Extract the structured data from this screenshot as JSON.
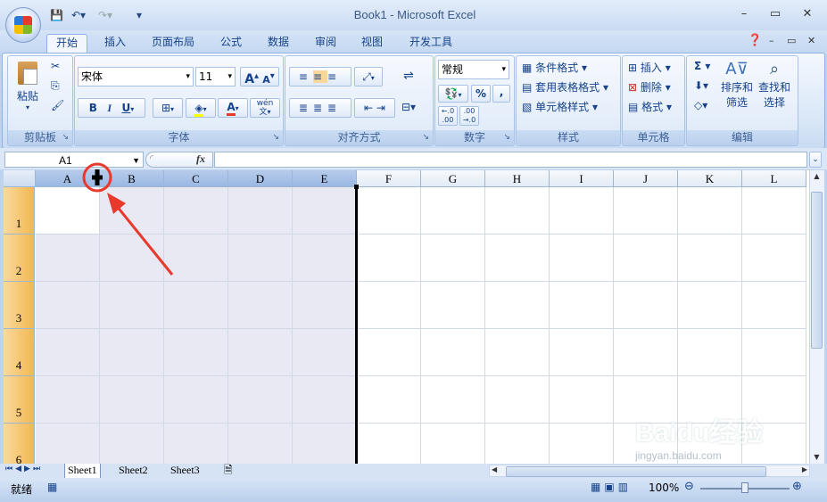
{
  "app": {
    "title": "Book1 - Microsoft Excel",
    "controls": {
      "minimize": "–",
      "restore": "▭",
      "close": "✕"
    }
  },
  "tabs": [
    "开始",
    "插入",
    "页面布局",
    "公式",
    "数据",
    "审阅",
    "视图",
    "开发工具"
  ],
  "ribbon": {
    "clipboard": {
      "label": "剪贴板",
      "paste": "粘贴"
    },
    "font": {
      "label": "字体",
      "font_name": "宋体",
      "font_size": "11",
      "bold": "B",
      "italic": "I",
      "underline": "U",
      "grow": "A",
      "shrink": "A",
      "phonetic": "wén"
    },
    "alignment": {
      "label": "对齐方式"
    },
    "number": {
      "label": "数字",
      "format": "常规",
      "percent": "%",
      "comma": ","
    },
    "styles": {
      "label": "样式",
      "conditional": "条件格式",
      "table": "套用表格格式",
      "cell": "单元格样式"
    },
    "cells": {
      "label": "单元格",
      "insert": "插入",
      "delete": "删除",
      "format": "格式"
    },
    "editing": {
      "label": "编辑",
      "sort": "排序和",
      "sort2": "筛选",
      "find": "查找和",
      "find2": "选择",
      "sigma": "Σ"
    }
  },
  "formula_bar": {
    "name_box": "A1",
    "fx": "fx",
    "formula": ""
  },
  "grid": {
    "columns": [
      "A",
      "B",
      "C",
      "D",
      "E",
      "F",
      "G",
      "H",
      "I",
      "J",
      "K",
      "L"
    ],
    "rows": [
      "1",
      "2",
      "3",
      "4",
      "5",
      "6"
    ]
  },
  "sheets": [
    "Sheet1",
    "Sheet2",
    "Sheet3"
  ],
  "status": {
    "ready": "就绪",
    "zoom": "100%"
  },
  "watermark": {
    "brand": "Baidu经验",
    "url": "jingyan.baidu.com"
  },
  "colors": {
    "accent": "#e8392c",
    "selection": "#f2b84e",
    "ribbon_text": "#15428b"
  }
}
